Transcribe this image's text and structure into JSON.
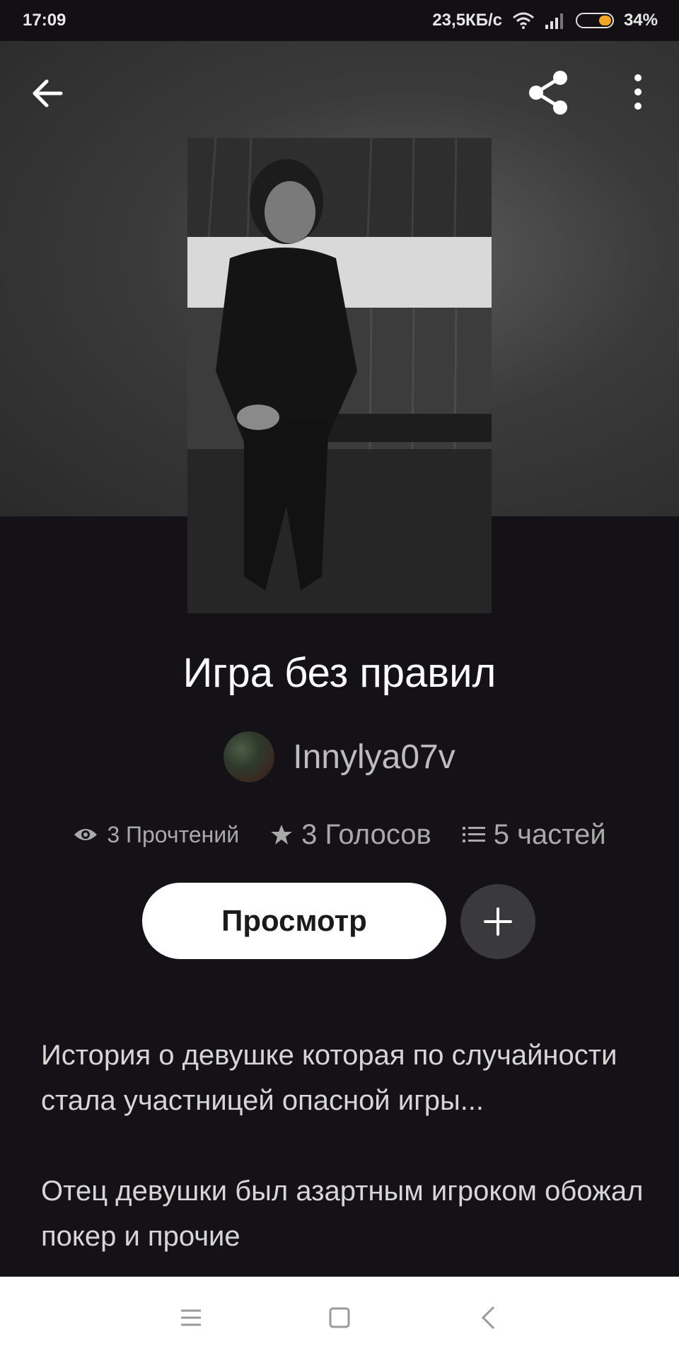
{
  "status_bar": {
    "time": "17:09",
    "network_speed": "23,5КБ/с",
    "battery": "34%",
    "battery_level": 0.34,
    "accent_color": "#f3a623"
  },
  "toolbar": {
    "back_icon": "arrow-left-icon",
    "share_icon": "share-icon",
    "more_icon": "more-vertical-icon"
  },
  "story": {
    "title": "Игра без правил",
    "author": "Innylya07v",
    "reads": "3 Прочтений",
    "votes": "3 Голосов",
    "parts": "5 частей",
    "read_button": "Просмотр",
    "add_icon": "plus-icon",
    "description_1": "История о девушке которая по случайности стала участницей опасной игры...",
    "description_2": "Отец девушки был азартным игроком обожал покер и прочие"
  },
  "nav": {
    "menu_icon": "menu-icon",
    "home_icon": "square-icon",
    "back_icon": "chevron-left-icon"
  }
}
